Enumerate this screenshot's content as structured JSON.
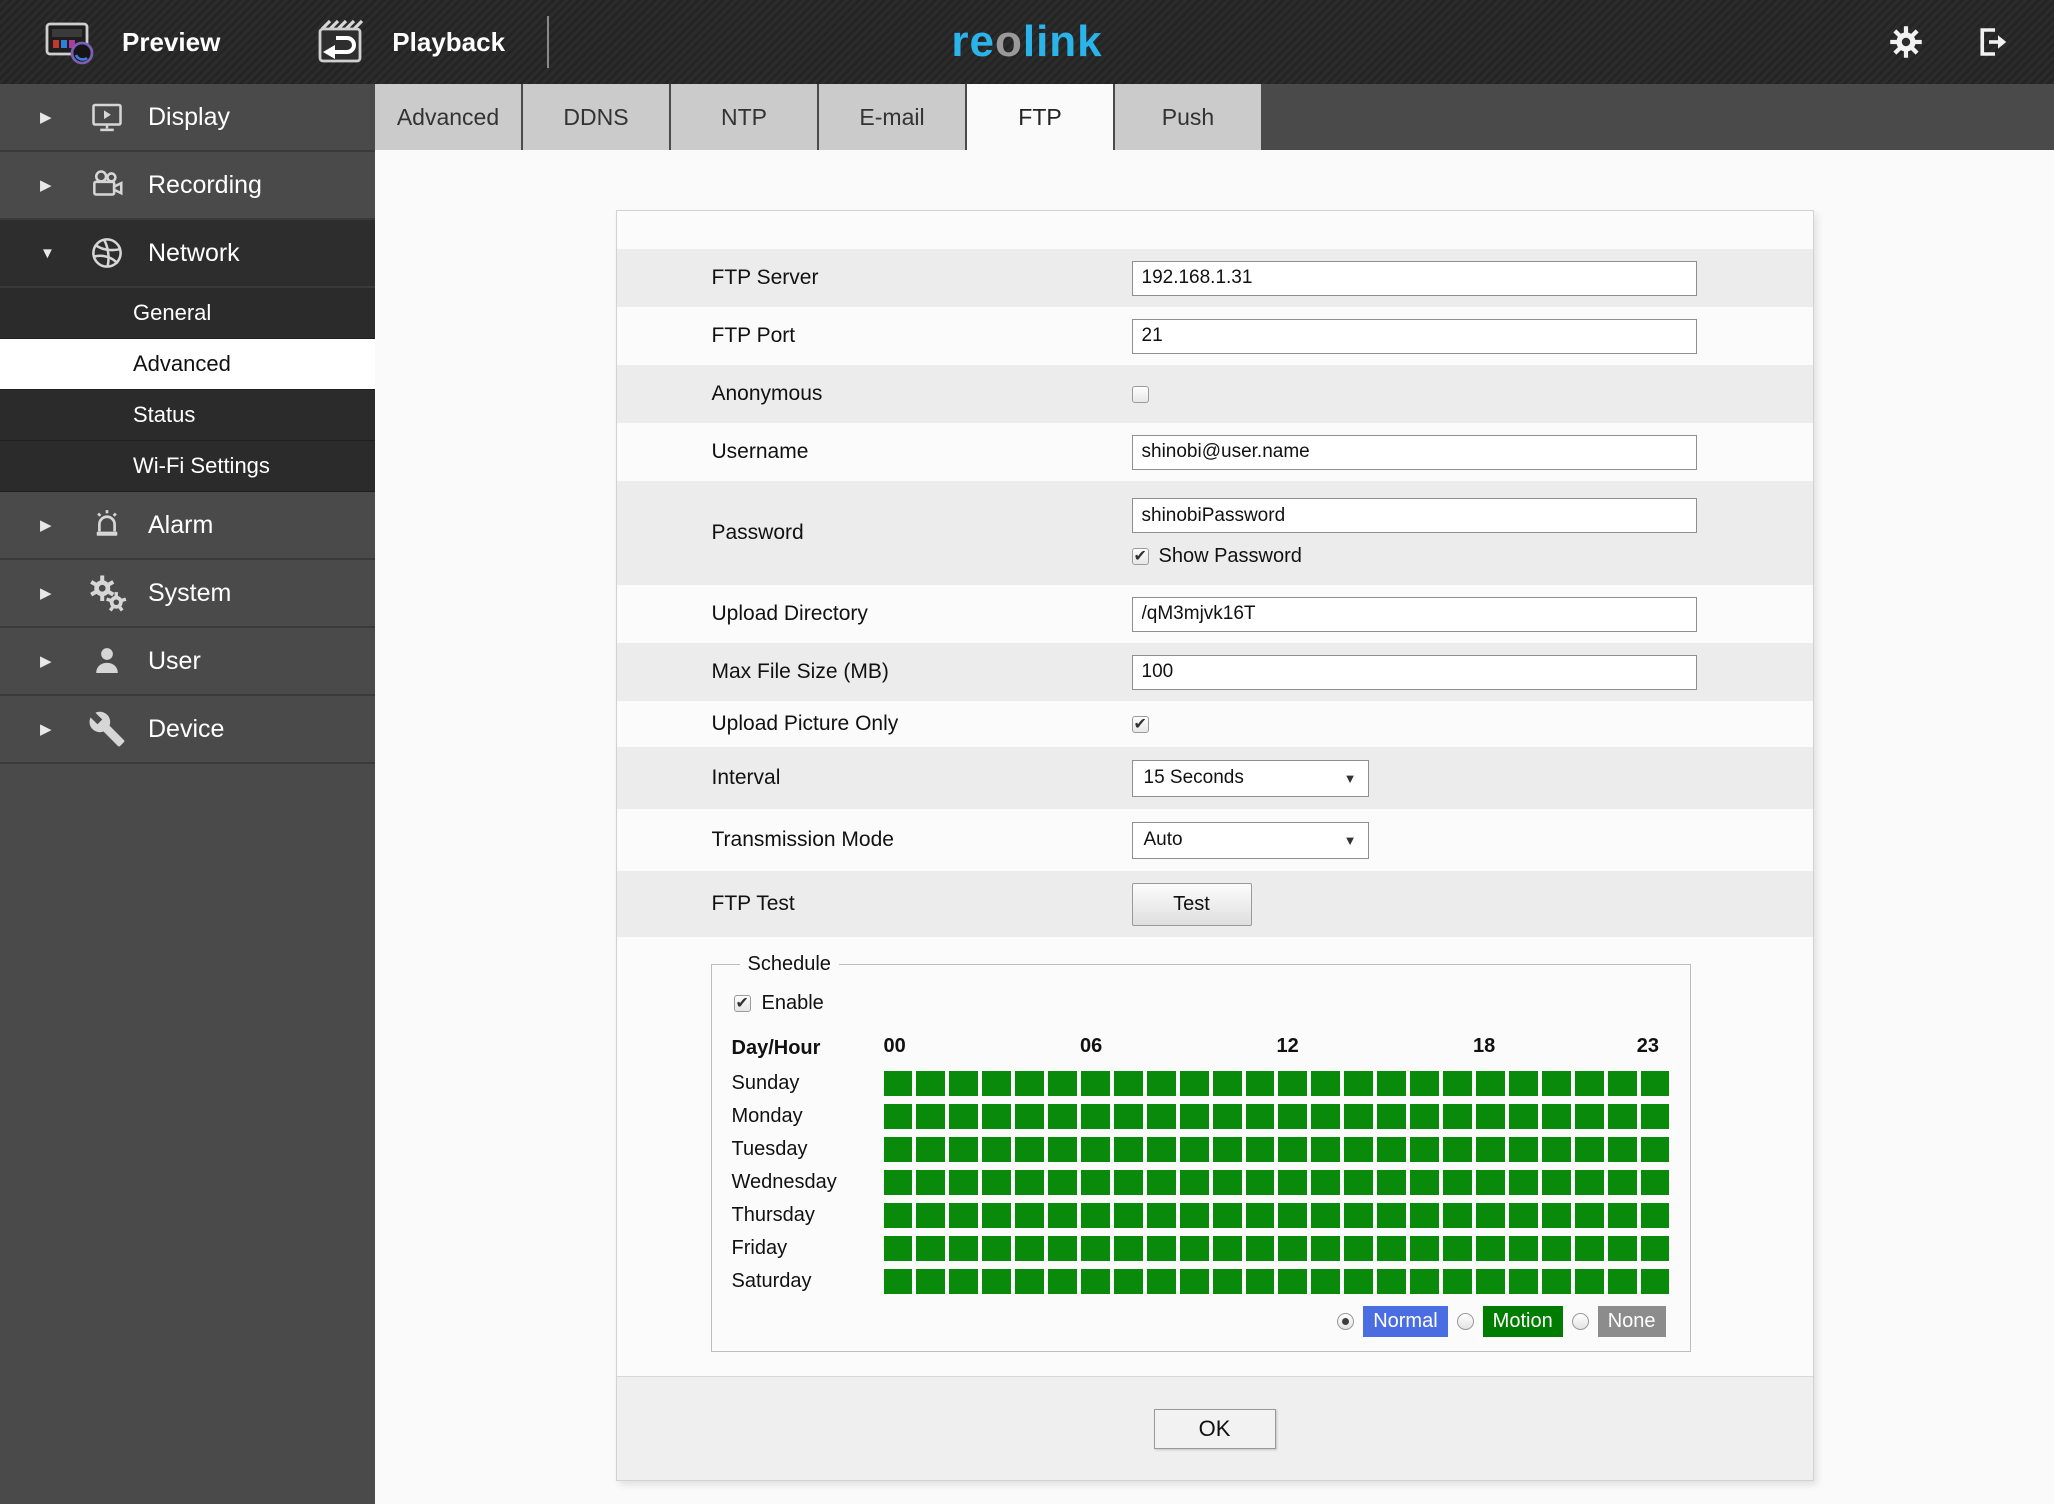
{
  "header": {
    "preview_label": "Preview",
    "playback_label": "Playback",
    "logo": {
      "part1": "re",
      "part2": "o",
      "part3": "link",
      "brand_color": "#2bb4ea",
      "o_color": "#9a9a9a"
    }
  },
  "tabs": {
    "items": [
      {
        "label": "Advanced",
        "active": false
      },
      {
        "label": "DDNS",
        "active": false
      },
      {
        "label": "NTP",
        "active": false
      },
      {
        "label": "E-mail",
        "active": false
      },
      {
        "label": "FTP",
        "active": true
      },
      {
        "label": "Push",
        "active": false
      }
    ]
  },
  "sidebar": {
    "items": [
      {
        "label": "Display",
        "icon": "display-icon",
        "expanded": false
      },
      {
        "label": "Recording",
        "icon": "recording-icon",
        "expanded": false
      },
      {
        "label": "Network",
        "icon": "network-icon",
        "expanded": true,
        "children": [
          {
            "label": "General",
            "selected": false
          },
          {
            "label": "Advanced",
            "selected": true
          },
          {
            "label": "Status",
            "selected": false
          },
          {
            "label": "Wi-Fi Settings",
            "selected": false
          }
        ]
      },
      {
        "label": "Alarm",
        "icon": "alarm-icon",
        "expanded": false
      },
      {
        "label": "System",
        "icon": "system-icon",
        "expanded": false
      },
      {
        "label": "User",
        "icon": "user-icon",
        "expanded": false
      },
      {
        "label": "Device",
        "icon": "device-icon",
        "expanded": false
      }
    ]
  },
  "form": {
    "ftp_server": {
      "label": "FTP Server",
      "value": "192.168.1.31"
    },
    "ftp_port": {
      "label": "FTP Port",
      "value": "21"
    },
    "anonymous": {
      "label": "Anonymous",
      "checked": false
    },
    "username": {
      "label": "Username",
      "value": "shinobi@user.name"
    },
    "password": {
      "label": "Password",
      "value": "shinobiPassword",
      "show_password_label": "Show Password",
      "show_password_checked": true
    },
    "upload_directory": {
      "label": "Upload Directory",
      "value": "/qM3mjvk16T"
    },
    "max_file_size": {
      "label": "Max File Size (MB)",
      "value": "100"
    },
    "upload_picture_only": {
      "label": "Upload Picture Only",
      "checked": true
    },
    "interval": {
      "label": "Interval",
      "value": "15 Seconds"
    },
    "transmission_mode": {
      "label": "Transmission Mode",
      "value": "Auto"
    },
    "ftp_test": {
      "label": "FTP Test",
      "button_label": "Test"
    }
  },
  "schedule": {
    "legend": "Schedule",
    "enable_label": "Enable",
    "enable_checked": true,
    "day_hour_label": "Day/Hour",
    "columns": 24,
    "hour_labels": [
      {
        "text": "00",
        "col": 0
      },
      {
        "text": "06",
        "col": 6
      },
      {
        "text": "12",
        "col": 12
      },
      {
        "text": "18",
        "col": 18
      },
      {
        "text": "23",
        "col": 23
      }
    ],
    "days": [
      "Sunday",
      "Monday",
      "Tuesday",
      "Wednesday",
      "Thursday",
      "Friday",
      "Saturday"
    ],
    "all_cells_state": "selected",
    "cell_color": "#0a8a0a",
    "modes": [
      {
        "label": "Normal",
        "color": "#4a6de1",
        "selected": true
      },
      {
        "label": "Motion",
        "color": "#007c00",
        "selected": false
      },
      {
        "label": "None",
        "color": "#8c8c8c",
        "selected": false
      }
    ]
  },
  "footer": {
    "ok_label": "OK"
  }
}
